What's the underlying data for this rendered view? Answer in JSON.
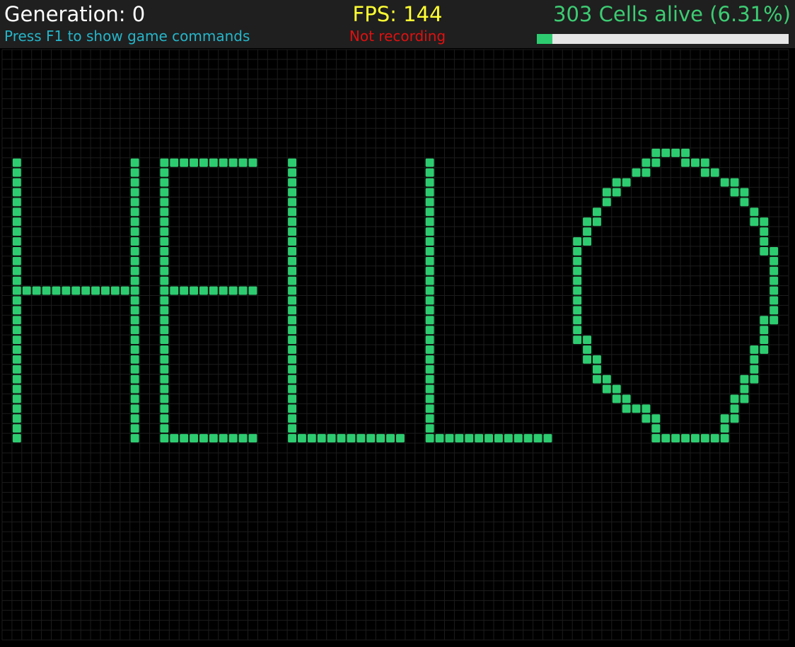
{
  "hud": {
    "generation_text": "Generation: 0",
    "help_text": "Press F1 to show game commands",
    "fps_text": "FPS: 144",
    "recording_text": "Not recording",
    "alive_text": "303 Cells alive (6.31%)",
    "alive_fraction": 0.0631
  },
  "colors": {
    "hud_background": "#1f1f1f",
    "generation": "#ffffff",
    "help": "#26b5c9",
    "fps": "#ffff33",
    "recording": "#e01010",
    "alive": "#3dcc73",
    "bar_track": "#e6e6e6",
    "bar_fill": "#2ecc71",
    "cell_alive": "#2ecc71",
    "grid_line": "#1c1c1c",
    "board_background": "#000000"
  },
  "board": {
    "columns": 80,
    "rows": 60,
    "live_cells": [
      [
        1,
        11
      ],
      [
        13,
        11
      ],
      [
        16,
        11
      ],
      [
        17,
        11
      ],
      [
        18,
        11
      ],
      [
        19,
        11
      ],
      [
        20,
        11
      ],
      [
        21,
        11
      ],
      [
        22,
        11
      ],
      [
        23,
        11
      ],
      [
        24,
        11
      ],
      [
        25,
        11
      ],
      [
        29,
        11
      ],
      [
        43,
        11
      ],
      [
        1,
        12
      ],
      [
        13,
        12
      ],
      [
        16,
        12
      ],
      [
        29,
        12
      ],
      [
        43,
        12
      ],
      [
        1,
        13
      ],
      [
        13,
        13
      ],
      [
        16,
        13
      ],
      [
        29,
        13
      ],
      [
        43,
        13
      ],
      [
        1,
        14
      ],
      [
        13,
        14
      ],
      [
        16,
        14
      ],
      [
        29,
        14
      ],
      [
        43,
        14
      ],
      [
        1,
        15
      ],
      [
        13,
        15
      ],
      [
        16,
        15
      ],
      [
        29,
        15
      ],
      [
        43,
        15
      ],
      [
        1,
        16
      ],
      [
        13,
        16
      ],
      [
        16,
        16
      ],
      [
        29,
        16
      ],
      [
        43,
        16
      ],
      [
        1,
        17
      ],
      [
        13,
        17
      ],
      [
        16,
        17
      ],
      [
        29,
        17
      ],
      [
        43,
        17
      ],
      [
        1,
        18
      ],
      [
        13,
        18
      ],
      [
        16,
        18
      ],
      [
        29,
        18
      ],
      [
        43,
        18
      ],
      [
        1,
        19
      ],
      [
        13,
        19
      ],
      [
        16,
        19
      ],
      [
        29,
        19
      ],
      [
        43,
        19
      ],
      [
        1,
        20
      ],
      [
        13,
        20
      ],
      [
        16,
        20
      ],
      [
        29,
        20
      ],
      [
        43,
        20
      ],
      [
        1,
        21
      ],
      [
        13,
        21
      ],
      [
        16,
        21
      ],
      [
        29,
        21
      ],
      [
        43,
        21
      ],
      [
        1,
        22
      ],
      [
        13,
        22
      ],
      [
        16,
        22
      ],
      [
        29,
        22
      ],
      [
        43,
        22
      ],
      [
        1,
        23
      ],
      [
        13,
        23
      ],
      [
        16,
        23
      ],
      [
        29,
        23
      ],
      [
        43,
        23
      ],
      [
        1,
        24
      ],
      [
        2,
        24
      ],
      [
        3,
        24
      ],
      [
        4,
        24
      ],
      [
        5,
        24
      ],
      [
        6,
        24
      ],
      [
        7,
        24
      ],
      [
        8,
        24
      ],
      [
        9,
        24
      ],
      [
        10,
        24
      ],
      [
        11,
        24
      ],
      [
        12,
        24
      ],
      [
        13,
        24
      ],
      [
        16,
        24
      ],
      [
        17,
        24
      ],
      [
        18,
        24
      ],
      [
        19,
        24
      ],
      [
        20,
        24
      ],
      [
        21,
        24
      ],
      [
        22,
        24
      ],
      [
        23,
        24
      ],
      [
        24,
        24
      ],
      [
        25,
        24
      ],
      [
        29,
        24
      ],
      [
        43,
        24
      ],
      [
        1,
        25
      ],
      [
        13,
        25
      ],
      [
        16,
        25
      ],
      [
        29,
        25
      ],
      [
        43,
        25
      ],
      [
        1,
        26
      ],
      [
        13,
        26
      ],
      [
        16,
        26
      ],
      [
        29,
        26
      ],
      [
        43,
        26
      ],
      [
        1,
        27
      ],
      [
        13,
        27
      ],
      [
        16,
        27
      ],
      [
        29,
        27
      ],
      [
        43,
        27
      ],
      [
        1,
        28
      ],
      [
        13,
        28
      ],
      [
        16,
        28
      ],
      [
        29,
        28
      ],
      [
        43,
        28
      ],
      [
        1,
        29
      ],
      [
        13,
        29
      ],
      [
        16,
        29
      ],
      [
        29,
        29
      ],
      [
        43,
        29
      ],
      [
        1,
        30
      ],
      [
        13,
        30
      ],
      [
        16,
        30
      ],
      [
        29,
        30
      ],
      [
        43,
        30
      ],
      [
        1,
        31
      ],
      [
        13,
        31
      ],
      [
        16,
        31
      ],
      [
        29,
        31
      ],
      [
        43,
        31
      ],
      [
        1,
        32
      ],
      [
        13,
        32
      ],
      [
        16,
        32
      ],
      [
        29,
        32
      ],
      [
        43,
        32
      ],
      [
        1,
        33
      ],
      [
        13,
        33
      ],
      [
        16,
        33
      ],
      [
        29,
        33
      ],
      [
        43,
        33
      ],
      [
        1,
        34
      ],
      [
        13,
        34
      ],
      [
        16,
        34
      ],
      [
        29,
        34
      ],
      [
        43,
        34
      ],
      [
        1,
        35
      ],
      [
        13,
        35
      ],
      [
        16,
        35
      ],
      [
        29,
        35
      ],
      [
        43,
        35
      ],
      [
        1,
        36
      ],
      [
        13,
        36
      ],
      [
        16,
        36
      ],
      [
        29,
        36
      ],
      [
        43,
        36
      ],
      [
        1,
        37
      ],
      [
        13,
        37
      ],
      [
        16,
        37
      ],
      [
        29,
        37
      ],
      [
        43,
        37
      ],
      [
        1,
        38
      ],
      [
        13,
        38
      ],
      [
        16,
        38
      ],
      [
        29,
        38
      ],
      [
        43,
        38
      ],
      [
        1,
        39
      ],
      [
        13,
        39
      ],
      [
        16,
        39
      ],
      [
        17,
        39
      ],
      [
        18,
        39
      ],
      [
        19,
        39
      ],
      [
        20,
        39
      ],
      [
        21,
        39
      ],
      [
        22,
        39
      ],
      [
        23,
        39
      ],
      [
        24,
        39
      ],
      [
        25,
        39
      ],
      [
        29,
        39
      ],
      [
        30,
        39
      ],
      [
        31,
        39
      ],
      [
        32,
        39
      ],
      [
        33,
        39
      ],
      [
        34,
        39
      ],
      [
        35,
        39
      ],
      [
        36,
        39
      ],
      [
        37,
        39
      ],
      [
        38,
        39
      ],
      [
        39,
        39
      ],
      [
        40,
        39
      ],
      [
        43,
        39
      ],
      [
        44,
        39
      ],
      [
        45,
        39
      ],
      [
        46,
        39
      ],
      [
        47,
        39
      ],
      [
        48,
        39
      ],
      [
        49,
        39
      ],
      [
        50,
        39
      ],
      [
        51,
        39
      ],
      [
        52,
        39
      ],
      [
        53,
        39
      ],
      [
        54,
        39
      ],
      [
        55,
        39
      ],
      [
        66,
        10
      ],
      [
        67,
        10
      ],
      [
        68,
        10
      ],
      [
        69,
        10
      ],
      [
        65,
        11
      ],
      [
        66,
        11
      ],
      [
        69,
        11
      ],
      [
        70,
        11
      ],
      [
        71,
        11
      ],
      [
        64,
        12
      ],
      [
        65,
        12
      ],
      [
        71,
        12
      ],
      [
        72,
        12
      ],
      [
        62,
        13
      ],
      [
        63,
        13
      ],
      [
        73,
        13
      ],
      [
        74,
        13
      ],
      [
        61,
        14
      ],
      [
        62,
        14
      ],
      [
        74,
        14
      ],
      [
        75,
        14
      ],
      [
        61,
        15
      ],
      [
        75,
        15
      ],
      [
        60,
        16
      ],
      [
        76,
        16
      ],
      [
        59,
        17
      ],
      [
        60,
        17
      ],
      [
        76,
        17
      ],
      [
        77,
        17
      ],
      [
        59,
        18
      ],
      [
        77,
        18
      ],
      [
        58,
        19
      ],
      [
        59,
        19
      ],
      [
        77,
        19
      ],
      [
        58,
        20
      ],
      [
        77,
        20
      ],
      [
        78,
        20
      ],
      [
        58,
        21
      ],
      [
        78,
        21
      ],
      [
        58,
        22
      ],
      [
        78,
        22
      ],
      [
        58,
        23
      ],
      [
        78,
        23
      ],
      [
        58,
        24
      ],
      [
        78,
        24
      ],
      [
        58,
        25
      ],
      [
        78,
        25
      ],
      [
        58,
        26
      ],
      [
        78,
        26
      ],
      [
        58,
        27
      ],
      [
        77,
        27
      ],
      [
        78,
        27
      ],
      [
        58,
        28
      ],
      [
        77,
        28
      ],
      [
        58,
        29
      ],
      [
        59,
        29
      ],
      [
        77,
        29
      ],
      [
        59,
        30
      ],
      [
        76,
        30
      ],
      [
        77,
        30
      ],
      [
        59,
        31
      ],
      [
        60,
        31
      ],
      [
        76,
        31
      ],
      [
        60,
        32
      ],
      [
        76,
        32
      ],
      [
        60,
        33
      ],
      [
        61,
        33
      ],
      [
        75,
        33
      ],
      [
        76,
        33
      ],
      [
        61,
        34
      ],
      [
        62,
        34
      ],
      [
        75,
        34
      ],
      [
        62,
        35
      ],
      [
        63,
        35
      ],
      [
        74,
        35
      ],
      [
        75,
        35
      ],
      [
        63,
        36
      ],
      [
        64,
        36
      ],
      [
        65,
        36
      ],
      [
        74,
        36
      ],
      [
        65,
        37
      ],
      [
        66,
        37
      ],
      [
        73,
        37
      ],
      [
        74,
        37
      ],
      [
        66,
        38
      ],
      [
        73,
        38
      ],
      [
        66,
        39
      ],
      [
        67,
        39
      ],
      [
        68,
        39
      ],
      [
        69,
        39
      ],
      [
        70,
        39
      ],
      [
        71,
        39
      ],
      [
        72,
        39
      ],
      [
        73,
        39
      ]
    ]
  }
}
